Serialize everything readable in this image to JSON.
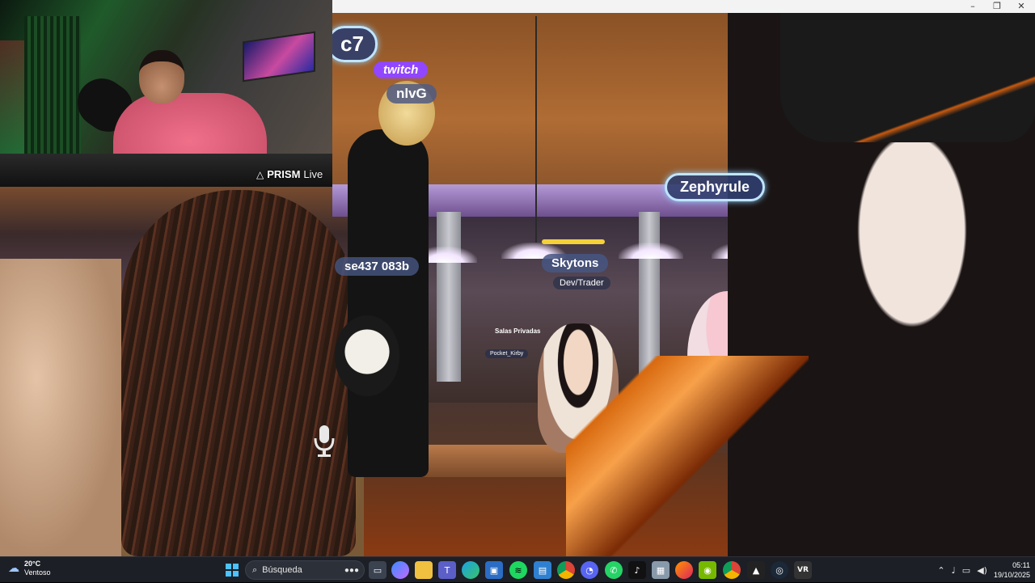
{
  "webcam": {
    "overlay_brand": "PRISM",
    "overlay_status": "Live"
  },
  "vr_scene": {
    "nametags": [
      "nlvG",
      "Zephyrule",
      "Skytons",
      "Dev/Trader",
      "se437 083b",
      "Salas Privadas",
      "Pocket_Kirby",
      "c7"
    ],
    "twitch_label": "twitch"
  },
  "colors": {
    "twitch": "#9146ff",
    "nametag_glow": "#bfe5ff",
    "taskbar": "#1c1f26"
  },
  "taskbar": {
    "weather_temp": "20°C",
    "weather_desc": "Ventoso",
    "search_placeholder": "Búsqueda",
    "apps": [
      "windows-start",
      "file-explorer-icon",
      "copilot-icon",
      "folder-icon",
      "teams-icon",
      "edge-icon",
      "store-icon",
      "spotify-icon",
      "window-icon",
      "chrome-icon",
      "discord-icon",
      "whatsapp-icon",
      "tiktok-icon",
      "photos-icon",
      "firefox-icon",
      "nvidia-icon",
      "chrome-icon-2",
      "vrchat-icon",
      "steam-icon",
      "vr-icon"
    ],
    "clock_time": "05:11",
    "clock_date": "19/10/2025"
  }
}
